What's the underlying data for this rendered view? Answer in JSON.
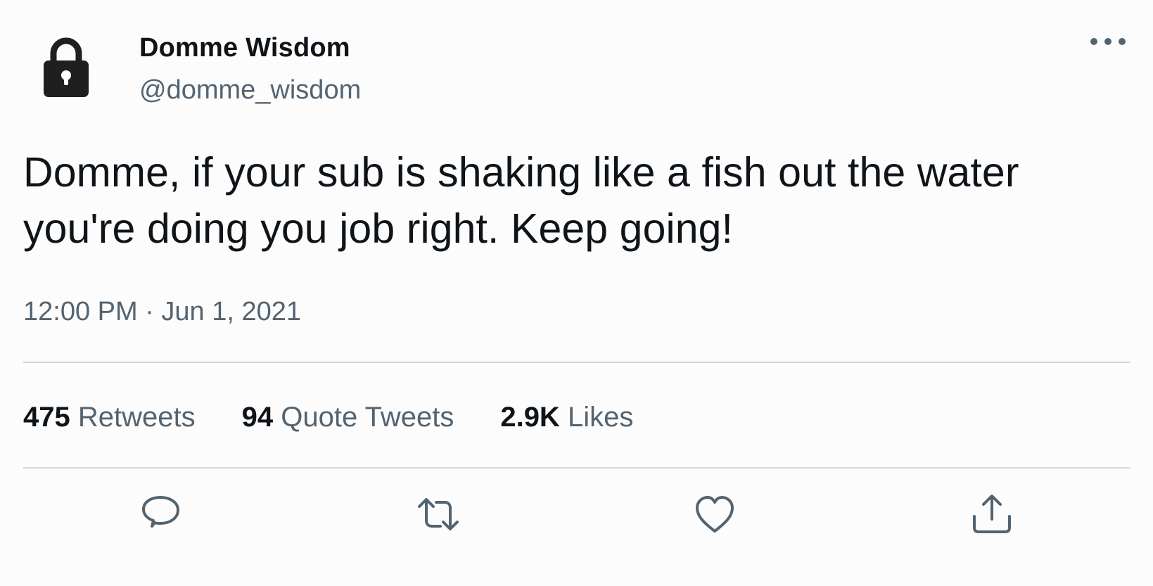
{
  "author": {
    "display_name": "Domme Wisdom",
    "handle": "@domme_wisdom",
    "avatar_icon": "lock-icon",
    "protected": true
  },
  "tweet": {
    "text": "Domme, if your sub is shaking like a fish out the water you're doing you job right. Keep going!",
    "timestamp": "12:00 PM · Jun 1, 2021"
  },
  "stats": {
    "retweets_count": "475",
    "retweets_label": "Retweets",
    "quotes_count": "94",
    "quotes_label": "Quote Tweets",
    "likes_count": "2.9K",
    "likes_label": "Likes"
  },
  "actions": {
    "reply_icon": "reply-icon",
    "retweet_icon": "retweet-icon",
    "like_icon": "heart-icon",
    "share_icon": "share-icon",
    "more_icon": "more-icon"
  },
  "colors": {
    "text_primary": "#0f1419",
    "text_secondary": "#536471",
    "divider": "#cfd9de",
    "background": "#fcfcfd"
  }
}
